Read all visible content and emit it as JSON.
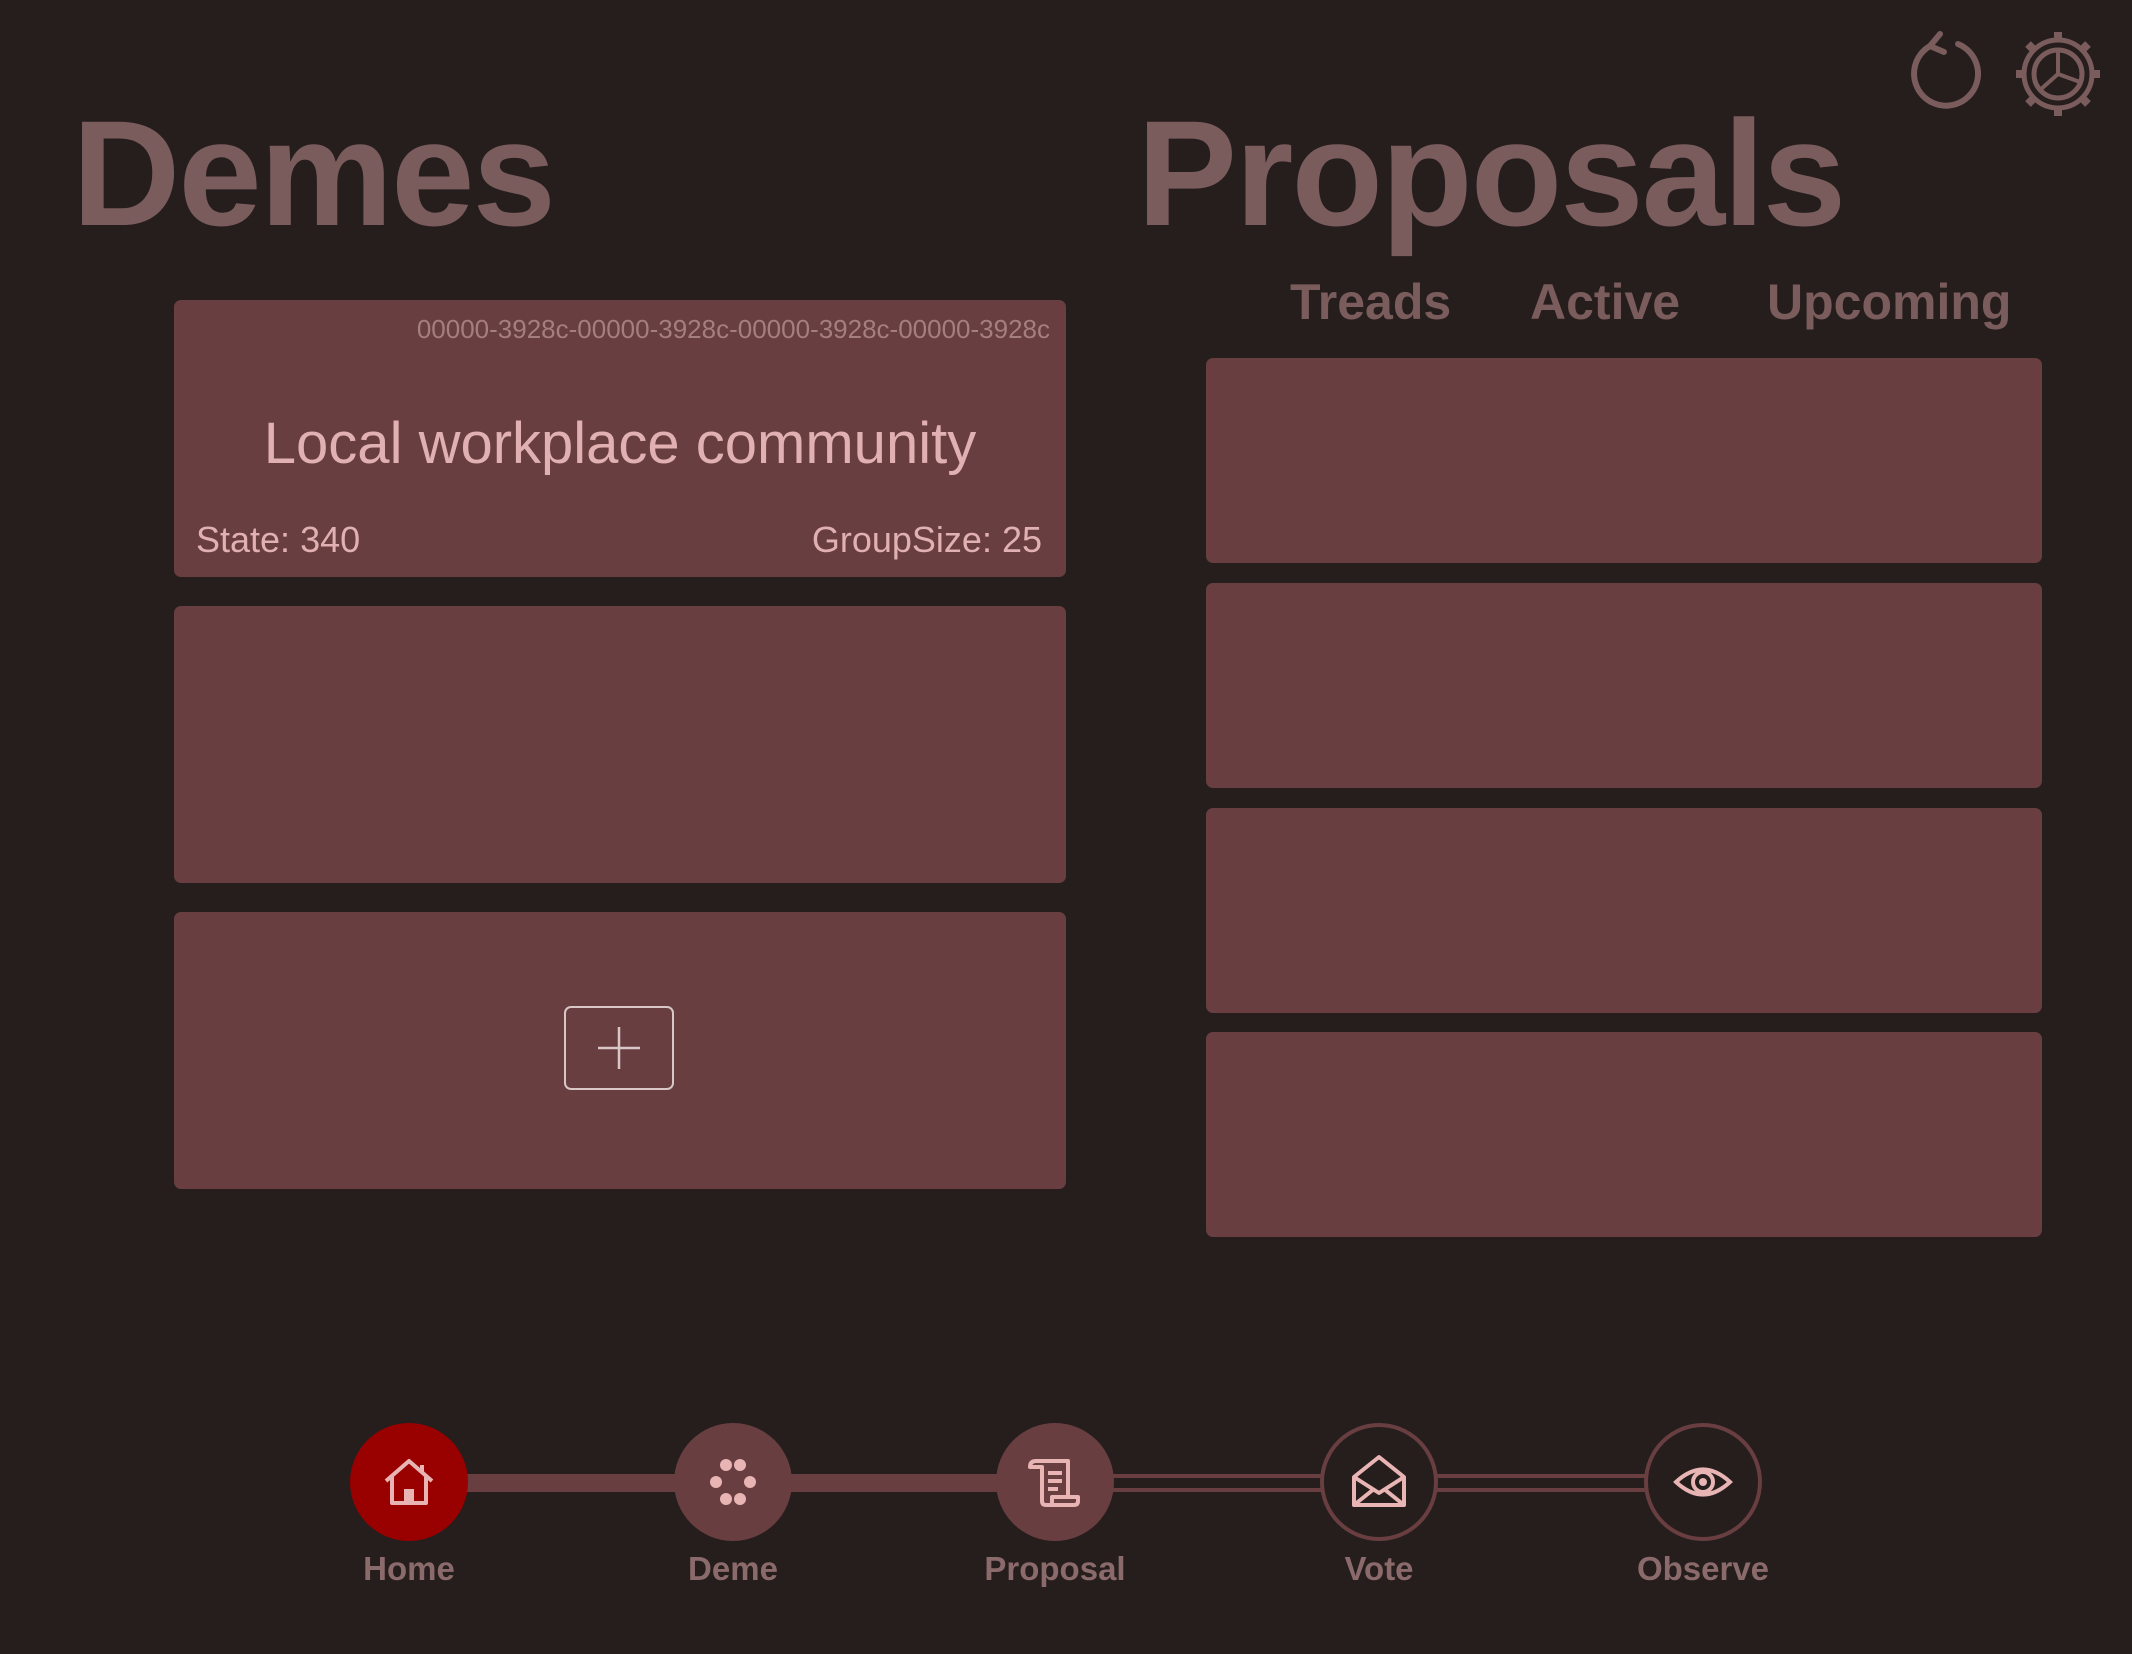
{
  "header": {
    "refresh_icon": "refresh-icon",
    "settings_icon": "gear-icon"
  },
  "demes": {
    "title": "Demes",
    "cards": [
      {
        "id": "00000-3928c-00000-3928c-00000-3928c-00000-3928c",
        "name": "Local workplace community",
        "state": "State: 340",
        "group_size": "GroupSize: 25"
      }
    ],
    "add_icon": "plus-icon"
  },
  "proposals": {
    "title": "Proposals",
    "tabs": [
      "Treads",
      "Active",
      "Upcoming"
    ]
  },
  "nav": {
    "items": [
      {
        "label": "Home",
        "icon": "home-icon",
        "active": true
      },
      {
        "label": "Deme",
        "icon": "dots-cluster-icon"
      },
      {
        "label": "Proposal",
        "icon": "scroll-icon"
      },
      {
        "label": "Vote",
        "icon": "envelope-open-icon"
      },
      {
        "label": "Observe",
        "icon": "eye-icon"
      }
    ]
  },
  "colors": {
    "background": "#261d1d",
    "card": "#683e40",
    "active_nav": "#990000",
    "heading": "#7a5c5c",
    "card_text": "#e0b0b2"
  }
}
